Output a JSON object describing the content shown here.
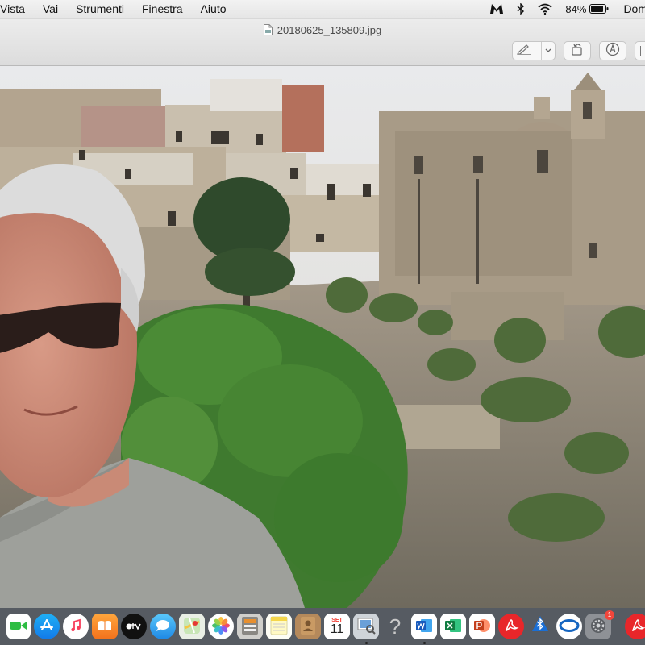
{
  "menubar": {
    "items": [
      "Vista",
      "Vai",
      "Strumenti",
      "Finestra",
      "Aiuto"
    ],
    "battery": "84%",
    "clock": "Dom"
  },
  "window": {
    "title": "20180625_135809.jpg"
  },
  "dock": {
    "calendar_month": "SET",
    "calendar_day": "11",
    "help_glyph": "?",
    "notification_badge": "1"
  }
}
